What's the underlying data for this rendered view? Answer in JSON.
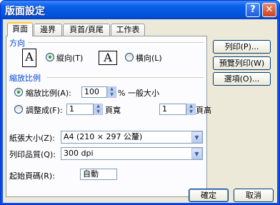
{
  "window": {
    "title": "版面設定"
  },
  "title_buttons": {
    "help": "?",
    "close": "✕"
  },
  "tabs": [
    {
      "label": "頁面",
      "active": true
    },
    {
      "label": "邊界",
      "active": false
    },
    {
      "label": "頁首/頁尾",
      "active": false
    },
    {
      "label": "工作表",
      "active": false
    }
  ],
  "orientation": {
    "group_label": "方向",
    "portrait_label": "縱向(T)",
    "landscape_label": "橫向(L)",
    "selected": "portrait",
    "portrait_icon": "A",
    "landscape_icon": "A"
  },
  "scaling": {
    "group_label": "縮放比例",
    "adjust_label": "縮放比例(A):",
    "adjust_value": "100",
    "adjust_suffix": "% 一般大小",
    "fit_label": "調整成(F):",
    "fit_wide_value": "1",
    "fit_wide_suffix": "頁寬",
    "fit_tall_value": "1",
    "fit_tall_suffix": "頁高",
    "selected": "adjust"
  },
  "paper_size": {
    "label": "紙張大小(Z):",
    "value": "A4 (210 × 297 公釐)"
  },
  "print_quality": {
    "label": "列印品質(Q):",
    "value": "300 dpi"
  },
  "first_page": {
    "label": "起始頁碼(R):",
    "value": "自動"
  },
  "side_buttons": {
    "print": "列印(P)...",
    "preview": "預覽列印(W)",
    "options": "選項(O)..."
  },
  "footer": {
    "ok": "確定",
    "cancel": "取消"
  }
}
